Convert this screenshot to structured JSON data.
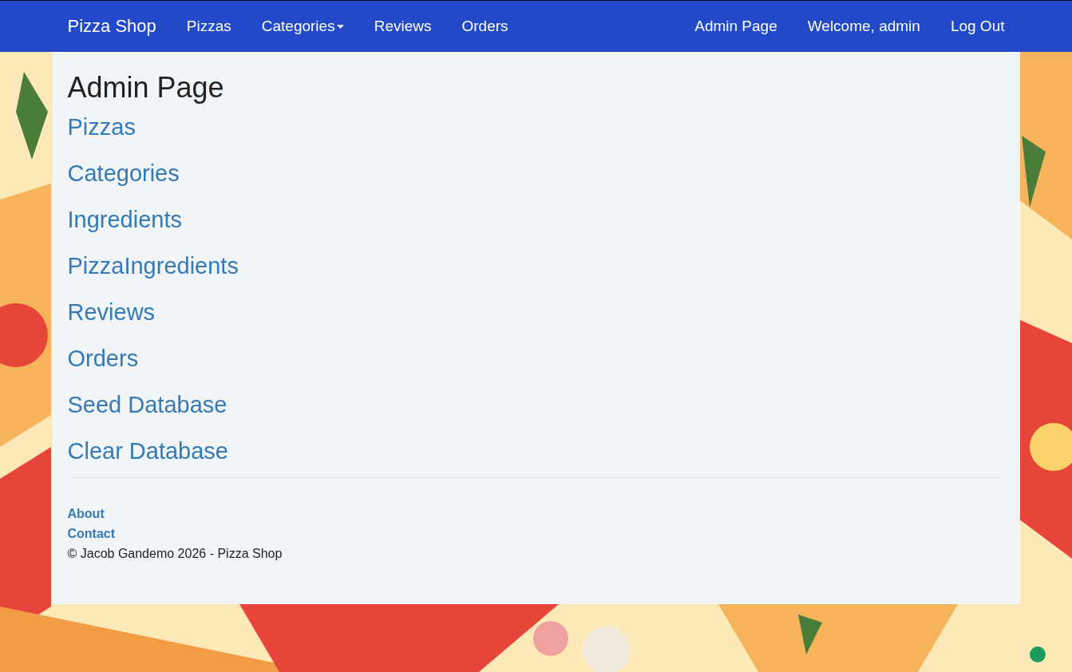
{
  "navbar": {
    "brand": "Pizza Shop",
    "left_items": [
      {
        "label": "Pizzas",
        "kind": "link"
      },
      {
        "label": "Categories",
        "kind": "dropdown"
      },
      {
        "label": "Reviews",
        "kind": "link"
      },
      {
        "label": "Orders",
        "kind": "link"
      }
    ],
    "right_items": [
      "Admin Page",
      "Welcome, admin",
      "Log Out"
    ]
  },
  "page": {
    "title": "Admin Page",
    "links": [
      "Pizzas",
      "Categories",
      "Ingredients",
      "PizzaIngredients",
      "Reviews",
      "Orders",
      "Seed Database",
      "Clear Database"
    ]
  },
  "footer": {
    "links": [
      "About",
      "Contact"
    ],
    "copyright": "© Jacob Gandemo 2026 - Pizza Shop"
  }
}
